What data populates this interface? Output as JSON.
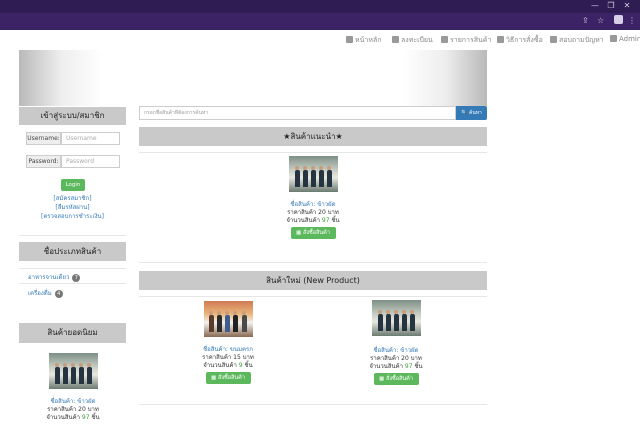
{
  "navbar": {
    "items": [
      {
        "label": "หน้าหลัก",
        "icon": "home-icon"
      },
      {
        "label": "ลงทะเบียน",
        "icon": "user-icon"
      },
      {
        "label": "รายการสินค้า",
        "icon": "list-icon"
      },
      {
        "label": "วิธีการสั่งซื้อ",
        "icon": "tag-icon"
      },
      {
        "label": "สอบถามปัญหา",
        "icon": "comment-icon"
      },
      {
        "label": "Admin",
        "icon": "lock-icon"
      }
    ]
  },
  "search": {
    "placeholder": "กรอกชื่อสินค้าที่ต้องการค้นหา",
    "button_label": "ค้นหา"
  },
  "login": {
    "title": "เข้าสู่ระบบ/สมาชิก",
    "username_label": "Username:",
    "username_placeholder": "Username",
    "password_label": "Password:",
    "password_placeholder": "Password",
    "login_button": "Login",
    "links": [
      "[สมัครสมาชิก]",
      "[ลืมรหัสผ่าน]",
      "[ตรวจสอบการชำระเงิน]"
    ]
  },
  "categories": {
    "title": "ชื่อประเภทสินค้า",
    "items": [
      {
        "label": "อาหารจานเดียว",
        "count": "7"
      },
      {
        "label": "เครื่องดื่ม",
        "count": "4"
      }
    ]
  },
  "popular": {
    "title": "สินค้ายอดนิยม",
    "product": {
      "name": "ชื่อสินค้า: ข้าวผัด",
      "price": "ราคาสินค้า 20 บาท",
      "stock_prefix": "จำนวนสินค้า",
      "stock_num": "97",
      "stock_suffix": "ชิ้น"
    }
  },
  "recommended": {
    "title": "★สินค้าแนะนำ★",
    "product": {
      "name": "ชื่อสินค้า: ข้าวผัด",
      "price": "ราคาสินค้า 20 บาท",
      "stock_prefix": "จำนวนสินค้า",
      "stock_num": "97",
      "stock_suffix": "ชิ้น",
      "buy": "สั่งซื้อสินค้า"
    }
  },
  "new_products": {
    "title": "สินค้าใหม่ (New Product)",
    "products": [
      {
        "name": "ชื่อสินค้า: ขนมครก",
        "price": "ราคาสินค้า 15 บาท",
        "stock_prefix": "จำนวนสินค้า",
        "stock_num": "9",
        "stock_suffix": "ชิ้น",
        "buy": "สั่งซื้อสินค้า"
      },
      {
        "name": "ชื่อสินค้า: ข้าวผัด",
        "price": "ราคาสินค้า 20 บาท",
        "stock_prefix": "จำนวนสินค้า",
        "stock_num": "97",
        "stock_suffix": "ชิ้น",
        "buy": "สั่งซื้อสินค้า"
      }
    ]
  },
  "colors": {
    "accent_green": "#5cb85c",
    "accent_blue": "#337ab7",
    "browser_frame": "#3b2366"
  }
}
